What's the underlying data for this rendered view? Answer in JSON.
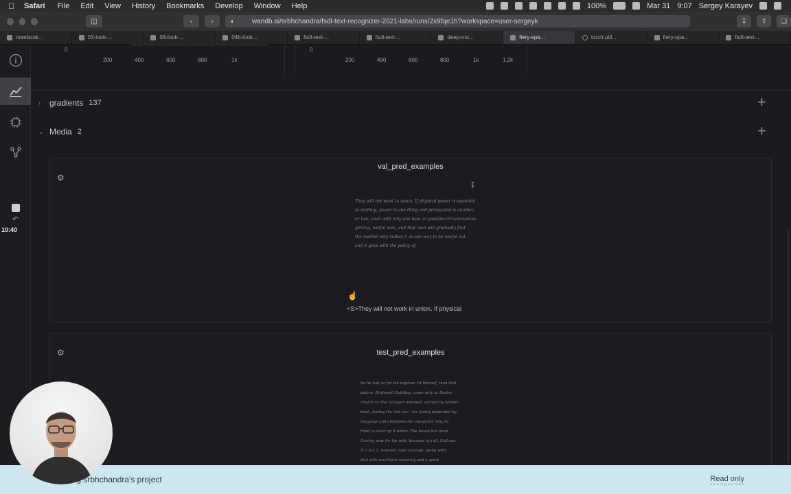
{
  "menubar": {
    "app": "Safari",
    "items": [
      "File",
      "Edit",
      "View",
      "History",
      "Bookmarks",
      "Develop",
      "Window",
      "Help"
    ],
    "battery": "100%",
    "date": "Mar 31",
    "time": "9:07",
    "user": "Sergey Karayev"
  },
  "browser": {
    "url": "wandb.ai/srbhchandra/fsdl-text-recognizer-2021-labs/runs/2x9fqe1h?workspace=user-sergeyk",
    "tabs": [
      {
        "label": "notebook..."
      },
      {
        "label": "03-look-..."
      },
      {
        "label": "04-look-..."
      },
      {
        "label": "04b-look..."
      },
      {
        "label": "fsdl-text-..."
      },
      {
        "label": "fsdl-text-..."
      },
      {
        "label": "deep-mo..."
      },
      {
        "label": "fiery-spa..."
      },
      {
        "label": "torch.util..."
      },
      {
        "label": "fiery-spa..."
      },
      {
        "label": "fsdl-text-..."
      }
    ]
  },
  "sidebar": {
    "clock": "10:40"
  },
  "charts_top": {
    "left_zero": "0",
    "left_ticks": [
      "200",
      "400",
      "600",
      "800",
      "1k"
    ],
    "right_zero": "0",
    "right_ticks": [
      "200",
      "400",
      "600",
      "800",
      "1k",
      "1.2k"
    ]
  },
  "sections": {
    "gradients": {
      "label": "gradients",
      "count": "137"
    },
    "media": {
      "label": "Media",
      "count": "2"
    }
  },
  "panels": {
    "val": {
      "title": "val_pred_examples",
      "prediction": "<S>They will not work in union. If physical",
      "handwriting": [
        "They will not work in union. If physical power is essential",
        "to nothing, power is one thing and persuasion is another,",
        "or two, each with only one man or possible circumstances.",
        "getting, useful men, and that men will gradually find",
        "the market only makes it as one way to be useful out",
        "and it goes with the policy of"
      ]
    },
    "test": {
      "title": "test_pred_examples",
      "handwriting": [
        "So he had as for the nephew I'd himself, then that",
        "palace. Bridewell Building, came only as Barton",
        "church to The Granger whelped, carried by women",
        "book, during the last two - his family depended by",
        "Leggings and amputees the vanguard, long to",
        "tried to clear up it wrote. The house has been",
        "Grisley, now for his wife, because lug all, Sullivan",
        "N 2 d a 2. Assured, take courage, along with",
        "that side was there sincerely and a great"
      ]
    }
  },
  "banner": {
    "text": "...ing srbhchandra's project",
    "readonly": "Read only"
  }
}
